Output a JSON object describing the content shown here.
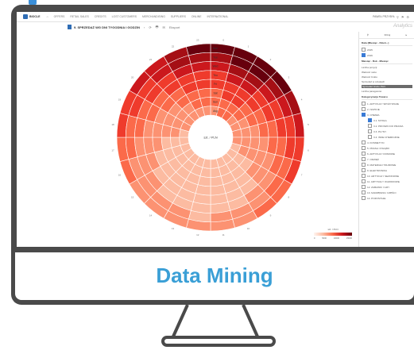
{
  "app": {
    "logo_text": "BIOCLE",
    "menu": [
      "OFFERS",
      "RETAIL SALES",
      "CREDITS",
      "LOST CUSTOMERS",
      "MERCHANDISING",
      "SUPPLIERS",
      "ONLINE",
      "INTERNATIONAL"
    ],
    "user": "PAWEŁ PRZYBYŁ",
    "brand": "Analytics",
    "report_title": "9. SPRZEDAŻ WG DNI TYGODNIA I GODZIN",
    "toolbar": {
      "back": "‹",
      "refresh": "⟳",
      "print": "🖶",
      "share": "✉",
      "export_label": "Eksport"
    }
  },
  "chart_data": {
    "type": "heatmap",
    "title": "",
    "center_label": "szt. / PLN",
    "rings": [
      "Mon",
      "Tue",
      "Wed",
      "Thu",
      "Fri",
      "Sat",
      "Sun",
      "Avg"
    ],
    "sectors": 24,
    "sector_labels": [
      "0",
      "1",
      "2",
      "3",
      "4",
      "5",
      "6",
      "7",
      "8",
      "9",
      "10",
      "11",
      "12",
      "13",
      "14",
      "15",
      "16",
      "17",
      "18",
      "19",
      "20",
      "21",
      "22",
      "23"
    ],
    "values": [
      [
        8,
        9,
        9,
        8,
        7,
        6,
        5,
        5,
        4,
        4,
        3,
        3,
        3,
        3,
        3,
        3,
        4,
        4,
        5,
        5,
        6,
        6,
        7,
        8
      ],
      [
        7,
        8,
        8,
        7,
        6,
        5,
        5,
        4,
        4,
        3,
        3,
        3,
        2,
        3,
        3,
        3,
        3,
        4,
        4,
        5,
        5,
        6,
        7,
        7
      ],
      [
        6,
        7,
        7,
        6,
        5,
        5,
        4,
        4,
        3,
        3,
        2,
        2,
        2,
        2,
        2,
        3,
        3,
        3,
        4,
        4,
        5,
        5,
        6,
        6
      ],
      [
        5,
        6,
        6,
        5,
        5,
        4,
        4,
        3,
        3,
        2,
        2,
        2,
        2,
        2,
        2,
        2,
        3,
        3,
        3,
        4,
        4,
        5,
        5,
        5
      ],
      [
        5,
        5,
        5,
        5,
        4,
        4,
        3,
        3,
        3,
        2,
        2,
        2,
        2,
        2,
        2,
        2,
        2,
        3,
        3,
        3,
        4,
        4,
        5,
        5
      ],
      [
        4,
        5,
        5,
        4,
        4,
        3,
        3,
        3,
        2,
        2,
        2,
        2,
        2,
        2,
        2,
        2,
        2,
        2,
        3,
        3,
        3,
        4,
        4,
        4
      ],
      [
        4,
        4,
        4,
        4,
        3,
        3,
        3,
        3,
        2,
        2,
        2,
        2,
        2,
        2,
        2,
        2,
        2,
        2,
        3,
        3,
        3,
        3,
        4,
        4
      ],
      [
        3,
        4,
        4,
        3,
        3,
        3,
        3,
        2,
        2,
        2,
        2,
        2,
        2,
        2,
        2,
        2,
        2,
        2,
        2,
        3,
        3,
        3,
        3,
        3
      ]
    ],
    "colors": [
      "#fff5f0",
      "#fee0d2",
      "#fcbba1",
      "#fc9272",
      "#fb6a4a",
      "#ef3b2c",
      "#cb181d",
      "#a50f15",
      "#67000d"
    ],
    "legend": {
      "title": "szt. / PLN",
      "ticks": [
        "0",
        "5000",
        "10000",
        "15000"
      ]
    }
  },
  "panel": {
    "header": [
      "⚲",
      "Filtruj",
      "▸"
    ],
    "sections": [
      {
        "title": "Data (Miesiąc - Dzień...)",
        "rows": [
          "2015",
          "2016"
        ]
      },
      {
        "title": "Miesiąc - Rok - Miesiąc",
        "rows": [
          "Liczba pozycji",
          "Wartość netto",
          "Wartość brutto",
          "Sprzedaż w sztukach",
          "Sprzedaż brutto PLN",
          "Liczba paragonów"
        ],
        "active_index": 4
      },
      {
        "title": "Kategoryzacja Towaru",
        "rows": [
          "1. ARTYKUŁY SPOŻYWCZE",
          "2. NAPOJE",
          "3. CHEMIA",
          "3.1. MYDŁA",
          "3.2. PROSZKI DO PRANIA",
          "3.3. PŁYNY",
          "3.4. INNE CHEMICZNE",
          "4. KOSMETYKI",
          "5. PRASA I KSIĄŻKI",
          "6. ARTYKUŁY DOMOWE",
          "7. ODZIEŻ",
          "8. MATERIAŁY BIUROWE",
          "9. ELEKTRONIKA",
          "10. ARTYKUŁY SEZONOWE",
          "11. ARTYKUŁY OGRODOWE",
          "12. ZABAWKI I GRY",
          "13. NARZĘDZIA I CZĘŚCI",
          "14. POZOSTAŁE"
        ]
      }
    ]
  },
  "device": {
    "caption": "Data Mining"
  }
}
